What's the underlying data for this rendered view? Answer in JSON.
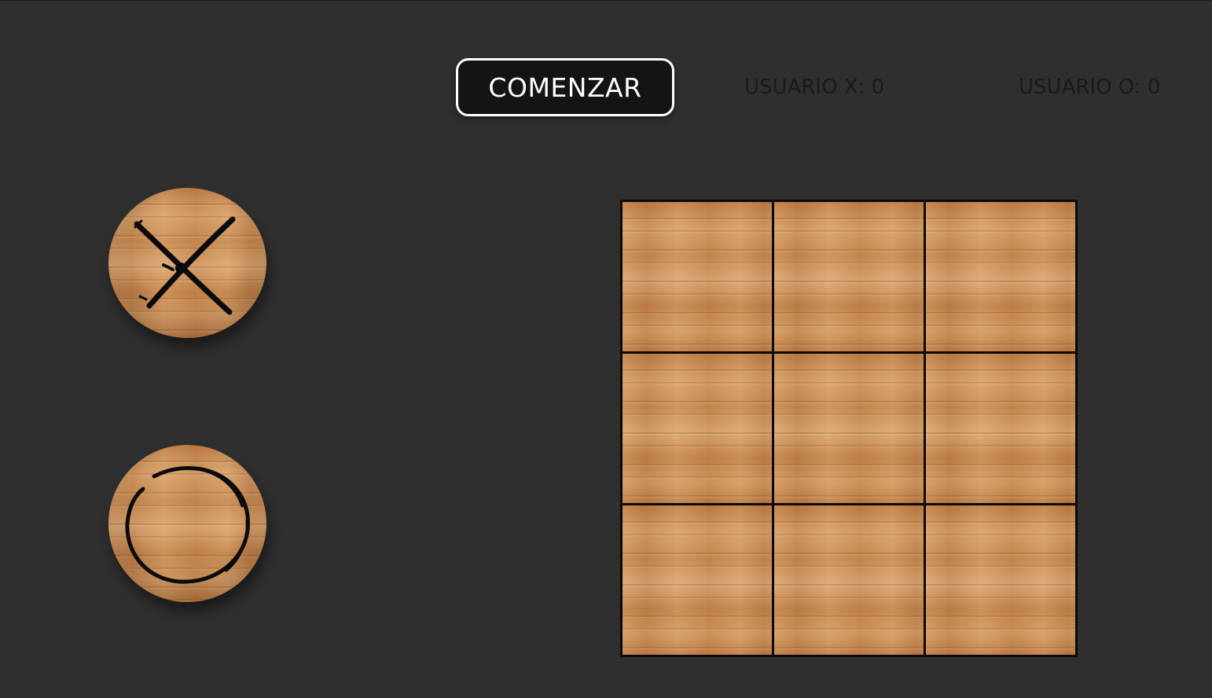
{
  "toolbar": {
    "start_label": "COMENZAR"
  },
  "scores": {
    "x_label": "USUARIO X: 0",
    "o_label": "USUARIO O: 0"
  },
  "pieces": [
    {
      "symbol": "X",
      "icon": "x-mark-icon"
    },
    {
      "symbol": "O",
      "icon": "o-mark-icon"
    }
  ],
  "board": {
    "rows": 3,
    "cols": 3,
    "cells": [
      "",
      "",
      "",
      "",
      "",
      "",
      "",
      "",
      ""
    ]
  },
  "colors": {
    "background": "#2f2f2f",
    "button_bg": "#141414",
    "button_border": "#ffffff",
    "score_text": "#1a1a1a",
    "wood": "#c98a4f",
    "grid_lines": "#0a0a0a"
  }
}
